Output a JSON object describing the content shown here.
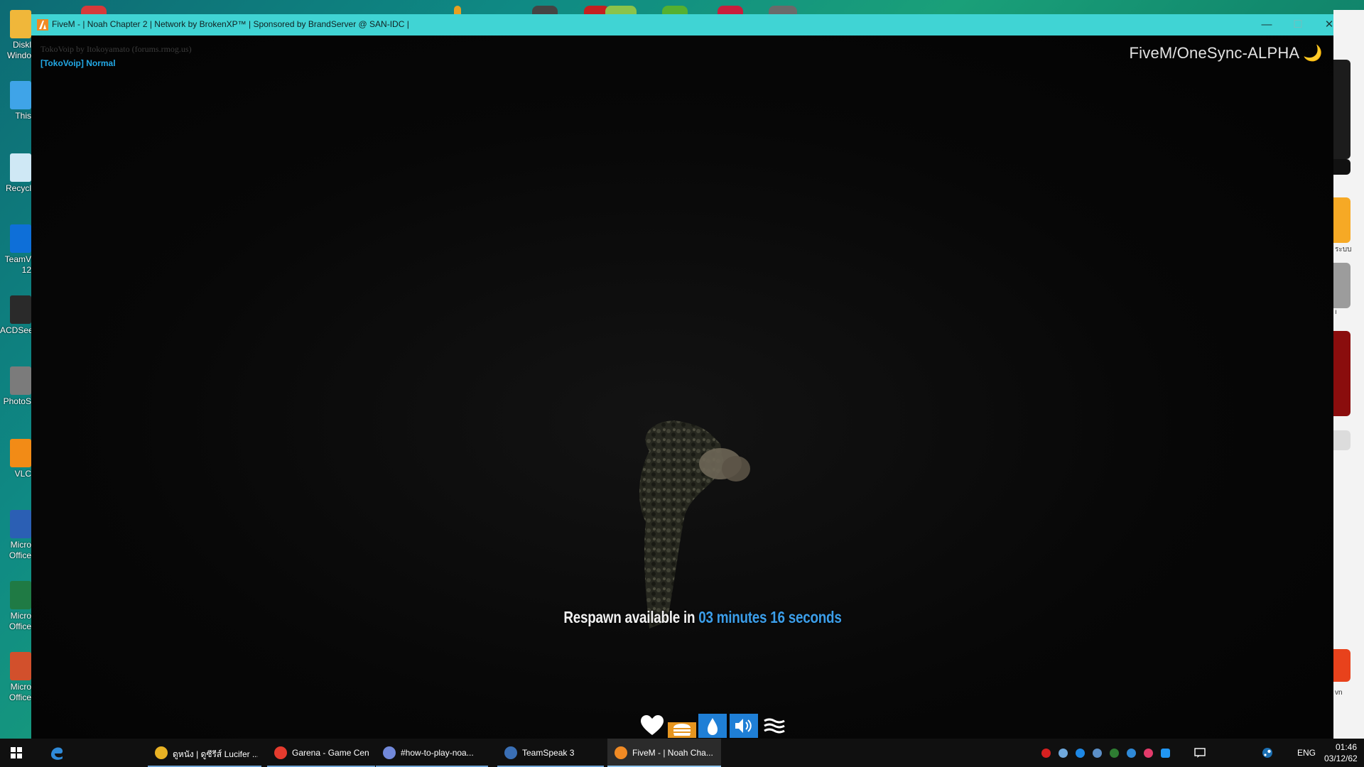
{
  "desktop": {
    "icons": [
      {
        "name": "desktop-icon-diskkeeper",
        "label": "Diskl\nWindo",
        "color": "#f0b73a"
      },
      {
        "name": "desktop-icon-this-pc",
        "label": "This",
        "color": "#3fa4e8"
      },
      {
        "name": "desktop-icon-recycle-bin",
        "label": "Recycl",
        "color": "#cfe8f5"
      },
      {
        "name": "desktop-icon-teamviewer",
        "label": "TeamV\n12",
        "color": "#0e6fd8"
      },
      {
        "name": "desktop-icon-acdsee",
        "label": "ACDSee",
        "color": "#2a2a2a"
      },
      {
        "name": "desktop-icon-photoscape",
        "label": "PhotoS",
        "color": "#7b7b7b"
      },
      {
        "name": "desktop-icon-vlc",
        "label": "VLC",
        "color": "#f28b16"
      },
      {
        "name": "desktop-icon-word",
        "label": "Micro\nOffice",
        "color": "#2b5fb4"
      },
      {
        "name": "desktop-icon-excel",
        "label": "Micro\nOffice",
        "color": "#1f7a44"
      },
      {
        "name": "desktop-icon-powerpoint",
        "label": "Micro\nOffice",
        "color": "#d2502c"
      }
    ],
    "right_widget_labels": [
      "ระบบ",
      "ı",
      "vn"
    ]
  },
  "window": {
    "title": "FiveM - | Noah Chapter 2 | Network by BrokenXP™ | Sponsored by BrandServer @ SAN-IDC |",
    "controls": {
      "minimize": "—",
      "maximize": "☐",
      "close": "✕"
    },
    "accent": "#40d4d4"
  },
  "game": {
    "voip_credit": "TokoVoip by Itokoyamato (forums.rmog.us)",
    "voip_status": "[TokoVoip] Normal",
    "server_name": "FiveM/OneSync-ALPHA",
    "server_icon": "🌙",
    "respawn_prefix": "Respawn available in",
    "respawn_time": "03 minutes 16 seconds",
    "status_icons": [
      {
        "name": "health-icon",
        "color": "#ffffff"
      },
      {
        "name": "hunger-icon",
        "color": "#f0a02a"
      },
      {
        "name": "thirst-icon",
        "color": "#2c8ee0"
      },
      {
        "name": "voice-icon",
        "color": "#2c8ee0"
      },
      {
        "name": "stamina-icon",
        "color": "#ffffff"
      }
    ]
  },
  "taskbar": {
    "items": [
      {
        "name": "taskbar-chrome",
        "label": "ดูหนัง | ดูซีรีส์ Lucifer ...",
        "icon_color": "#e8b224",
        "active": false
      },
      {
        "name": "taskbar-garena",
        "label": "Garena - Game Cen",
        "icon_color": "#e53b2e",
        "active": false
      },
      {
        "name": "taskbar-discord",
        "label": "#how-to-play-noa...",
        "icon_color": "#7289da",
        "active": false
      },
      {
        "name": "taskbar-teamspeak",
        "label": "TeamSpeak 3",
        "icon_color": "#3a6fb5",
        "active": false
      },
      {
        "name": "taskbar-fivem",
        "label": "FiveM - | Noah Cha...",
        "icon_color": "#f08a24",
        "active": true
      }
    ],
    "tray": {
      "language": "ENG",
      "time": "01:46",
      "date": "03/12/62"
    }
  }
}
